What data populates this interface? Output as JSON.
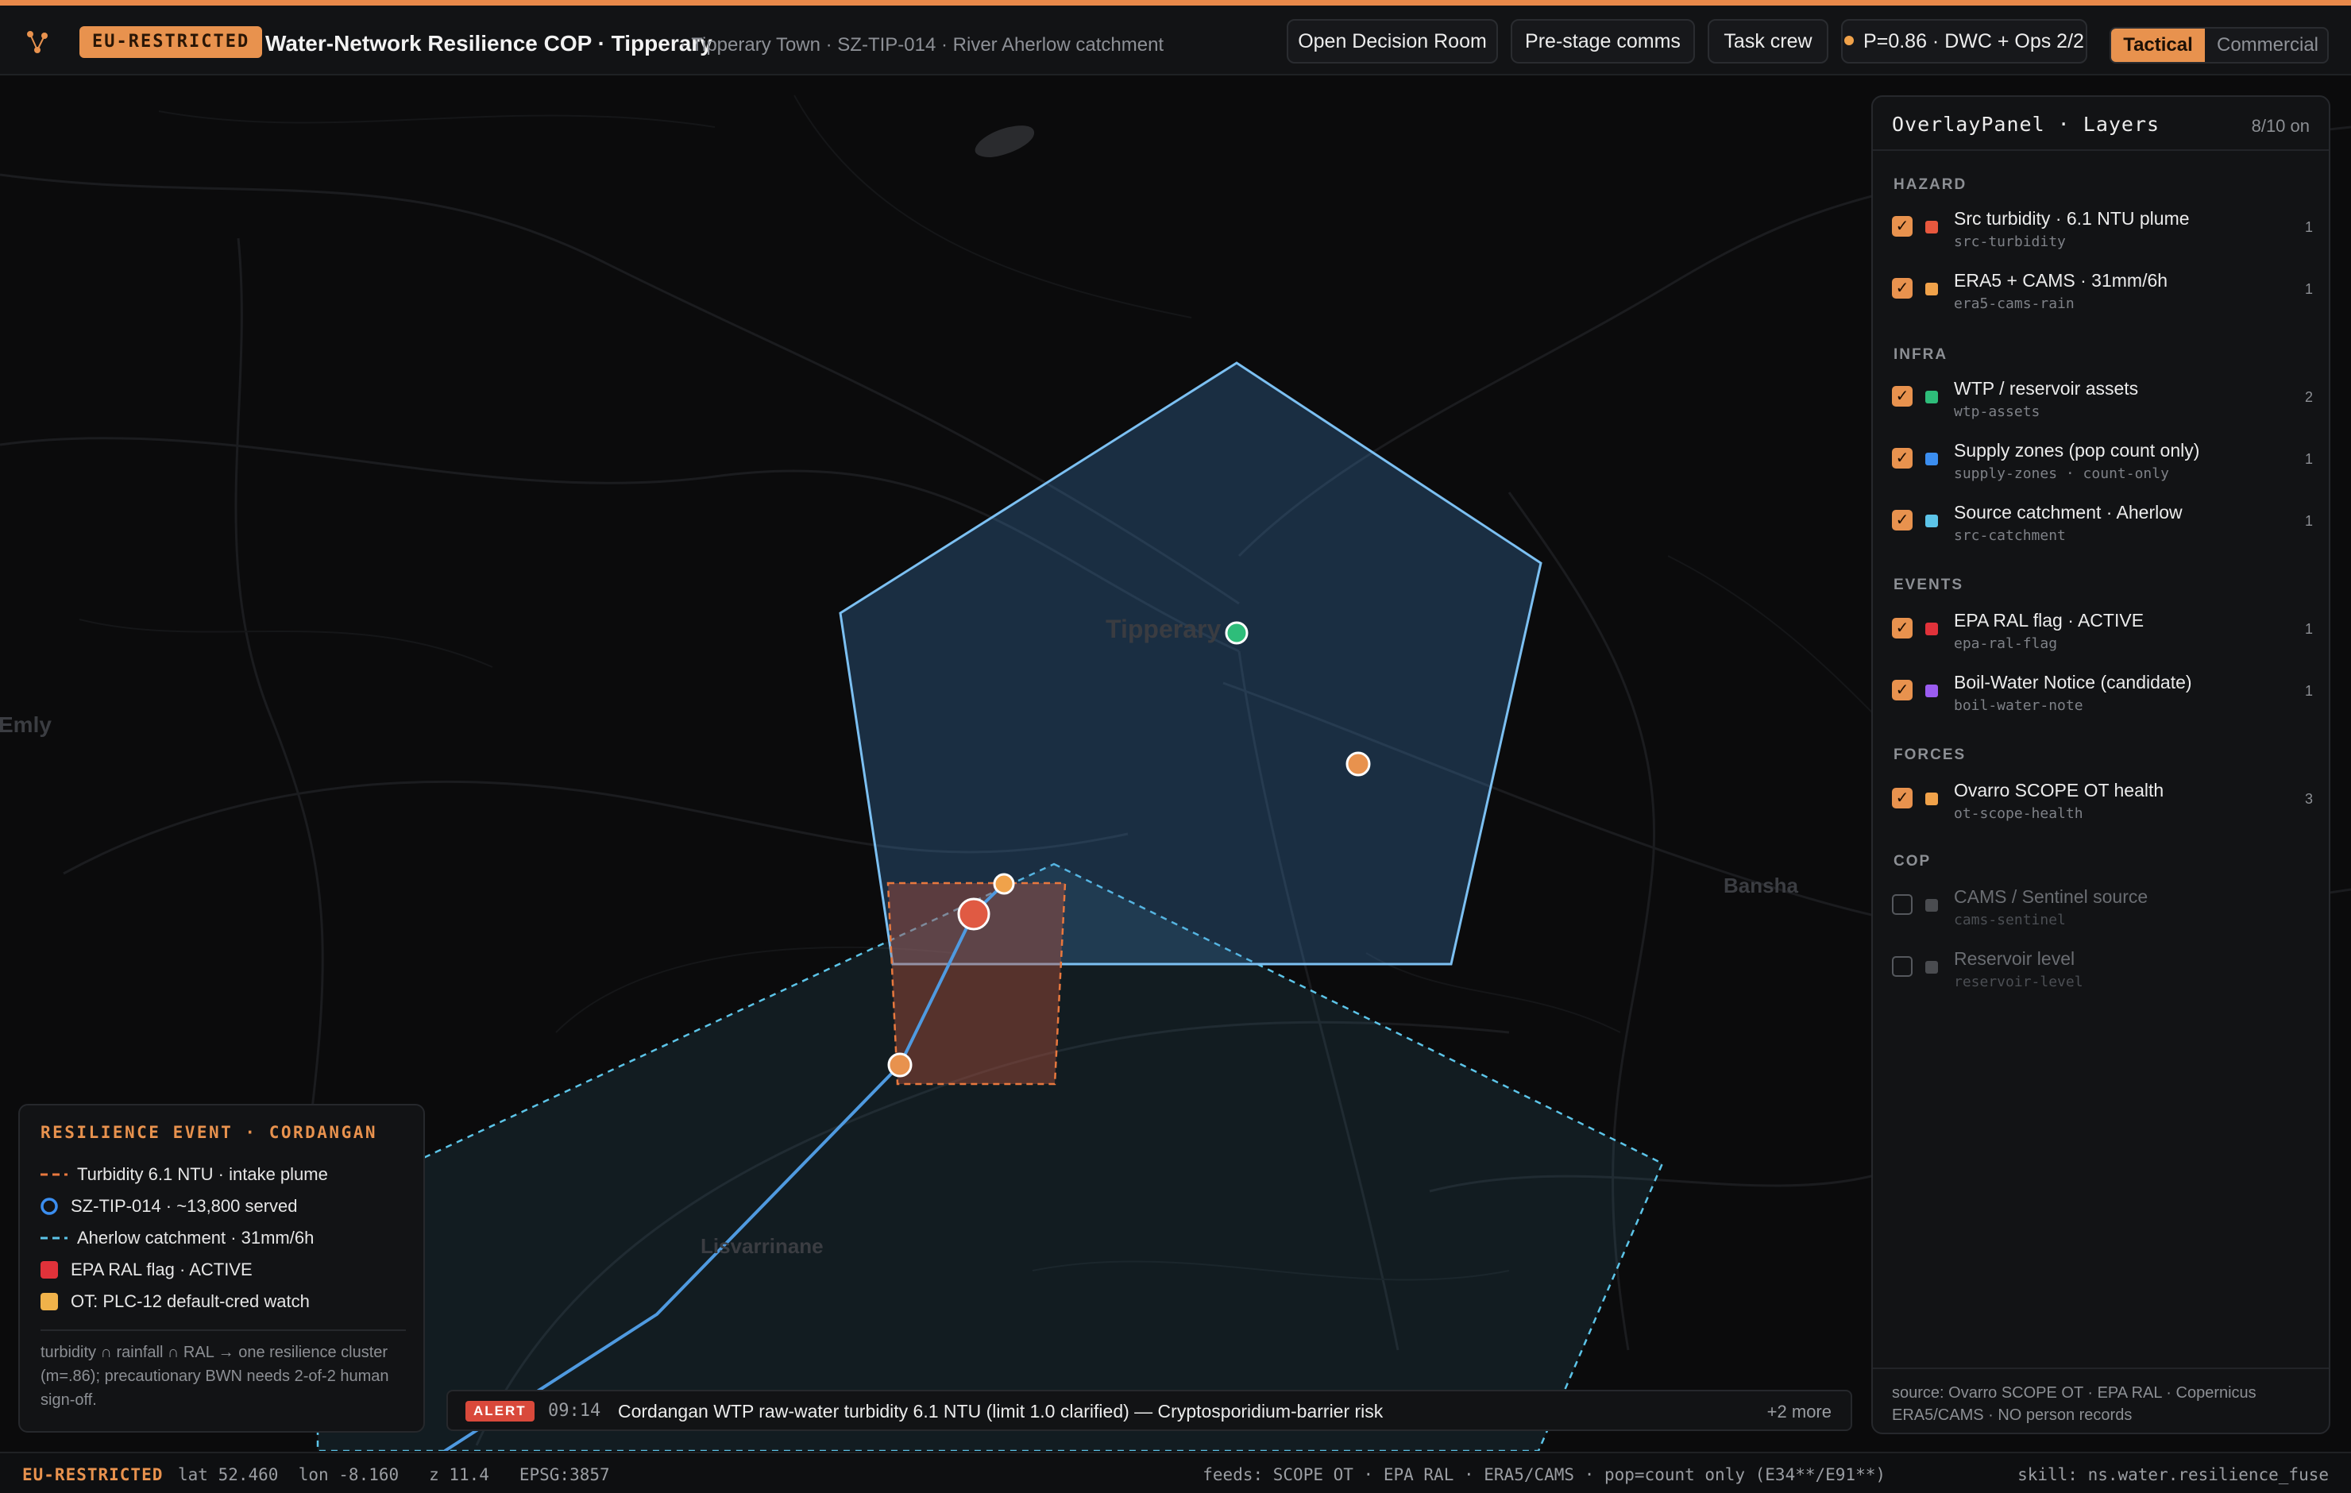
{
  "header": {
    "classification": "EU-RESTRICTED",
    "title": "Water-Network Resilience COP · Tipperary",
    "subtitle": "· Tipperary Town · SZ-TIP-014 · River Aherlow catchment",
    "buttons": {
      "decision_room": "Open Decision Room",
      "prestage_comms": "Pre-stage comms",
      "task_crew": "Task crew"
    },
    "probability": "P=0.86 · DWC + Ops 2/2",
    "mode": {
      "active": "Tactical",
      "inactive": "Commercial"
    }
  },
  "map": {
    "places": {
      "tipperary": "Tipperary",
      "emly": "Emly",
      "bansha": "Bansha",
      "lisvarrinane": "Lisvarrinane"
    },
    "colors": {
      "zone": "#6fb3ef",
      "catchment": "#5cc4e8",
      "turbidity": "#e8783e",
      "asset_green": "#2ebd7a",
      "asset_orange": "#f0a24a",
      "alert_red": "#e05a43"
    }
  },
  "overlay_panel": {
    "title": "OverlayPanel · Layers",
    "count": "8/10 on",
    "groups": [
      {
        "label": "HAZARD",
        "layers": [
          {
            "name": "Src turbidity · 6.1 NTU plume",
            "key": "src-turbidity",
            "count": "1",
            "color": "#e8583e",
            "on": true
          },
          {
            "name": "ERA5 + CAMS · 31mm/6h",
            "key": "era5-cams-rain",
            "count": "1",
            "color": "#f0a24a",
            "on": true
          }
        ]
      },
      {
        "label": "INFRA",
        "layers": [
          {
            "name": "WTP / reservoir assets",
            "key": "wtp-assets",
            "count": "2",
            "color": "#2ebd7a",
            "on": true
          },
          {
            "name": "Supply zones (pop count only)",
            "key": "supply-zones · count-only",
            "count": "1",
            "color": "#3b8ef0",
            "on": true
          },
          {
            "name": "Source catchment · Aherlow",
            "key": "src-catchment",
            "count": "1",
            "color": "#5cc4e8",
            "on": true
          }
        ]
      },
      {
        "label": "EVENTS",
        "layers": [
          {
            "name": "EPA RAL flag · ACTIVE",
            "key": "epa-ral-flag",
            "count": "1",
            "color": "#e0323a",
            "on": true
          },
          {
            "name": "Boil-Water Notice (candidate)",
            "key": "boil-water-note",
            "count": "1",
            "color": "#9a5cf0",
            "on": true
          }
        ]
      },
      {
        "label": "FORCES",
        "layers": [
          {
            "name": "Ovarro SCOPE OT health",
            "key": "ot-scope-health",
            "count": "3",
            "color": "#f0a24a",
            "on": true
          }
        ]
      },
      {
        "label": "COP",
        "layers": [
          {
            "name": "CAMS / Sentinel source",
            "key": "cams-sentinel",
            "count": "",
            "color": "#4a4c50",
            "on": false
          },
          {
            "name": "Reservoir level",
            "key": "reservoir-level",
            "count": "",
            "color": "#4a4c50",
            "on": false
          }
        ]
      }
    ],
    "footer": "source: Ovarro SCOPE OT · EPA RAL · Copernicus ERA5/CAMS · NO person records"
  },
  "legend": {
    "title": "RESILIENCE EVENT · CORDANGAN",
    "items": [
      {
        "label": "Turbidity 6.1 NTU · intake plume",
        "kind": "dash",
        "color": "#e8783e"
      },
      {
        "label": "SZ-TIP-014 · ~13,800 served",
        "kind": "ring",
        "color": "#3b8ef0"
      },
      {
        "label": "Aherlow catchment · 31mm/6h",
        "kind": "dash",
        "color": "#5cc4e8"
      },
      {
        "label": "EPA RAL flag · ACTIVE",
        "kind": "square",
        "color": "#e0323a"
      },
      {
        "label": "OT: PLC-12 default-cred watch",
        "kind": "square",
        "color": "#f0b24a"
      }
    ],
    "note": "turbidity ∩ rainfall ∩ RAL → one resilience cluster (m=.86); precautionary BWN needs 2-of-2 human sign-off."
  },
  "alert": {
    "tag": "ALERT",
    "time": "09:14",
    "message": "Cordangan WTP raw-water turbidity 6.1 NTU (limit 1.0 clarified) — Cryptosporidium-barrier risk",
    "more": "+2 more"
  },
  "status": {
    "classification": "EU-RESTRICTED",
    "coords": "lat 52.460  lon -8.160   z 11.4   EPSG:3857",
    "feeds": "feeds: SCOPE OT · EPA RAL · ERA5/CAMS · pop=count only (E34**/E91**)",
    "skill": "skill: ns.water.resilience_fuse"
  }
}
